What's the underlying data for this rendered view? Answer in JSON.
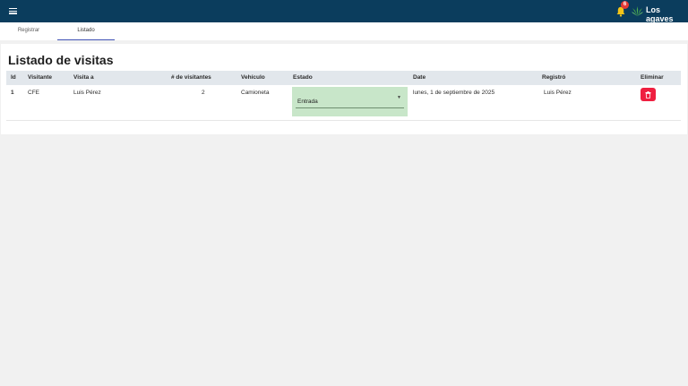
{
  "header": {
    "menu_icon": "hamburger-menu-icon",
    "notifications_icon": "bell-icon",
    "notifications_count": "6",
    "org_icon": "agave-leaf-icon",
    "org_name": "Los agaves",
    "colors": {
      "bar": "#0b3d5d",
      "badge": "#e53935",
      "bell": "#f5c518",
      "leaf": "#4caf50"
    }
  },
  "tabs": [
    {
      "label": "Registrar",
      "active": false
    },
    {
      "label": "Listado",
      "active": true
    }
  ],
  "main": {
    "title": "Listado de visitas",
    "columns": [
      "Id",
      "Visitante",
      "Visita a",
      "# de visitantes",
      "Vehículo",
      "Estado",
      "Date",
      "Registró",
      "Eliminar"
    ],
    "rows": [
      {
        "id": "1",
        "visitante": "CFE",
        "visita_a": "Luis Pérez",
        "num_visitantes": "2",
        "vehiculo": "Camioneta",
        "estado": "Entrada",
        "date": "lunes, 1 de septiembre de 2025",
        "registro": "Luis Pérez",
        "delete_icon": "trash-icon"
      }
    ],
    "colors": {
      "estado_bg": "#c8e6c9",
      "delete_bg": "#ef1f40",
      "header_bg": "#e2e7ec"
    }
  }
}
